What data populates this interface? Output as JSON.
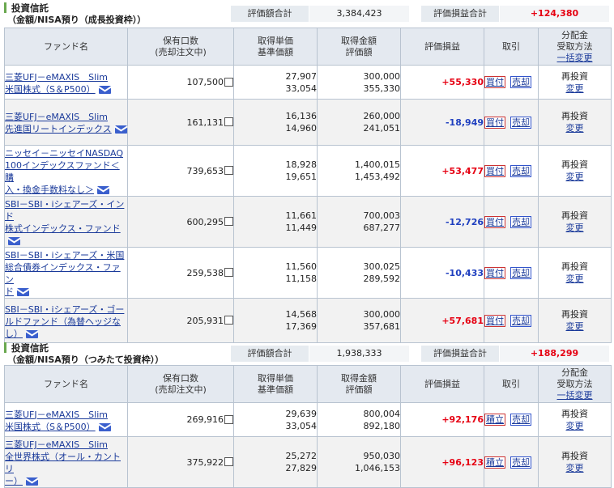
{
  "section1": {
    "title": "投資信託",
    "subtitle": "（金額/NISA預り（成長投資枠））",
    "summary": {
      "valuation_label": "評価額合計",
      "valuation_value": "3,384,423",
      "pnl_label": "評価損益合計",
      "pnl_value": "+124,380"
    },
    "headers": {
      "fund": "ファンド名",
      "qty1": "保有口数",
      "qty2": "(売却注文中)",
      "unit1": "取得単価",
      "unit2": "基準価額",
      "amt1": "取得金額",
      "amt2": "評価額",
      "pnl": "評価損益",
      "trade": "取引",
      "dist1": "分配金",
      "dist2": "受取方法",
      "dist3": "一括変更"
    },
    "rows": [
      {
        "fund_lines": [
          "三菱UFJ－eMAXIS　Slim",
          "米国株式（S＆P500）"
        ],
        "qty": "107,500",
        "cost": "27,907",
        "nav": "33,054",
        "cost_amount": "300,000",
        "value": "355,330",
        "pnl": "+55,330",
        "pnl_sign": "pos",
        "buy": "買付",
        "sell": "売却",
        "dist": "再投資",
        "change": "変更"
      },
      {
        "fund_lines": [
          "三菱UFJ－eMAXIS　Slim",
          "先進国リートインデックス"
        ],
        "qty": "161,131",
        "cost": "16,136",
        "nav": "14,960",
        "cost_amount": "260,000",
        "value": "241,051",
        "pnl": "-18,949",
        "pnl_sign": "neg",
        "buy": "買付",
        "sell": "売却",
        "dist": "再投資",
        "change": "変更"
      },
      {
        "fund_lines": [
          "ニッセイ－ニッセイNASDAQ",
          "100インデックスファンド＜購",
          "入・換金手数料なし＞"
        ],
        "qty": "739,653",
        "cost": "18,928",
        "nav": "19,651",
        "cost_amount": "1,400,015",
        "value": "1,453,492",
        "pnl": "+53,477",
        "pnl_sign": "pos",
        "buy": "買付",
        "sell": "売却",
        "dist": "再投資",
        "change": "変更"
      },
      {
        "fund_lines": [
          "SBI－SBI・iシェアーズ・インド",
          "株式インデックス・ファンド"
        ],
        "qty": "600,295",
        "cost": "11,661",
        "nav": "11,449",
        "cost_amount": "700,003",
        "value": "687,277",
        "pnl": "-12,726",
        "pnl_sign": "neg",
        "buy": "買付",
        "sell": "売却",
        "dist": "再投資",
        "change": "変更"
      },
      {
        "fund_lines": [
          "SBI－SBI・iシェアーズ・米国",
          "総合債券インデックス・ファン",
          "ド"
        ],
        "qty": "259,538",
        "cost": "11,560",
        "nav": "11,158",
        "cost_amount": "300,025",
        "value": "289,592",
        "pnl": "-10,433",
        "pnl_sign": "neg",
        "buy": "買付",
        "sell": "売却",
        "dist": "再投資",
        "change": "変更"
      },
      {
        "fund_lines": [
          "SBI－SBI・iシェアーズ・ゴー",
          "ルドファンド（為替ヘッジなし）"
        ],
        "qty": "205,931",
        "cost": "14,568",
        "nav": "17,369",
        "cost_amount": "300,000",
        "value": "357,681",
        "pnl": "+57,681",
        "pnl_sign": "pos",
        "buy": "買付",
        "sell": "売却",
        "dist": "再投資",
        "change": "変更"
      }
    ]
  },
  "section2": {
    "title": "投資信託",
    "subtitle": "（金額/NISA預り（つみたて投資枠））",
    "summary": {
      "valuation_label": "評価額合計",
      "valuation_value": "1,938,333",
      "pnl_label": "評価損益合計",
      "pnl_value": "+188,299"
    },
    "headers": {
      "fund": "ファンド名",
      "qty1": "保有口数",
      "qty2": "(売却注文中)",
      "unit1": "取得単価",
      "unit2": "基準価額",
      "amt1": "取得金額",
      "amt2": "評価額",
      "pnl": "評価損益",
      "trade": "取引",
      "dist1": "分配金",
      "dist2": "受取方法",
      "dist3": "一括変更"
    },
    "rows": [
      {
        "fund_lines": [
          "三菱UFJ－eMAXIS　Slim",
          "米国株式（S＆P500）"
        ],
        "qty": "269,916",
        "cost": "29,639",
        "nav": "33,054",
        "cost_amount": "800,004",
        "value": "892,180",
        "pnl": "+92,176",
        "pnl_sign": "pos",
        "buy": "積立",
        "sell": "売却",
        "dist": "再投資",
        "change": "変更"
      },
      {
        "fund_lines": [
          "三菱UFJ－eMAXIS　Slim",
          "全世界株式（オール・カントリ",
          "ー）"
        ],
        "qty": "375,922",
        "cost": "25,272",
        "nav": "27,829",
        "cost_amount": "950,030",
        "value": "1,046,153",
        "pnl": "+96,123",
        "pnl_sign": "pos",
        "buy": "積立",
        "sell": "売却",
        "dist": "再投資",
        "change": "変更"
      }
    ]
  },
  "colors": {
    "header_bg": "#e4e9f0",
    "border": "#b8c3d0",
    "positive": "#e60012",
    "negative": "#1f3fbf",
    "link": "#1a3a9a",
    "accent_green": "#6aa84f"
  }
}
